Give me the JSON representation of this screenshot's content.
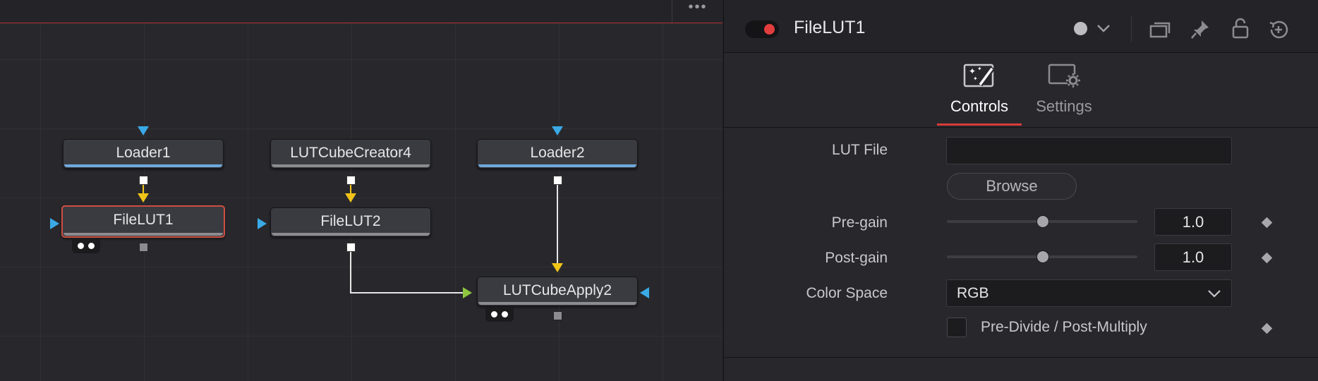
{
  "node_editor": {
    "menu_dots": "•••",
    "nodes": [
      {
        "id": "loader1",
        "label": "Loader1"
      },
      {
        "id": "lutcubecreator4",
        "label": "LUTCubeCreator4"
      },
      {
        "id": "loader2",
        "label": "Loader2"
      },
      {
        "id": "filelut1",
        "label": "FileLUT1",
        "selected": true
      },
      {
        "id": "filelut2",
        "label": "FileLUT2"
      },
      {
        "id": "lutcubeapply2",
        "label": "LUTCubeApply2"
      }
    ],
    "connections": [
      {
        "from": "Loader1",
        "to": "FileLUT1"
      },
      {
        "from": "LUTCubeCreator4",
        "to": "FileLUT2"
      },
      {
        "from": "Loader2",
        "to": "LUTCubeApply2"
      },
      {
        "from": "FileLUT2",
        "to": "LUTCubeApply2"
      }
    ],
    "colors": {
      "loader_stripe": "#6fa9dc",
      "tool_stripe": "#8c8c90",
      "selected_border": "#ce4e42",
      "input_triangle": "#3aa9e6",
      "main_input": "#f0c418",
      "effect_input": "#8ec63f"
    }
  },
  "inspector": {
    "title": "FileLUT1",
    "header_icons": [
      "color-dot-icon",
      "chevron-down-icon",
      "versions-icon",
      "pin-icon",
      "lock-icon",
      "reset-icon"
    ],
    "tabs": [
      {
        "label": "Controls",
        "icon": "magic-wand-icon",
        "active": true
      },
      {
        "label": "Settings",
        "icon": "settings-gear-icon",
        "active": false
      }
    ],
    "params": {
      "lut_file": {
        "label": "LUT File",
        "value": ""
      },
      "browse_label": "Browse",
      "pre_gain": {
        "label": "Pre-gain",
        "value": "1.0",
        "slider_fraction": 0.5
      },
      "post_gain": {
        "label": "Post-gain",
        "value": "1.0",
        "slider_fraction": 0.5
      },
      "color_space": {
        "label": "Color Space",
        "value": "RGB"
      },
      "pre_divide": {
        "label": "Pre-Divide / Post-Multiply",
        "checked": false
      }
    },
    "accent_color": "#d83b3b"
  }
}
